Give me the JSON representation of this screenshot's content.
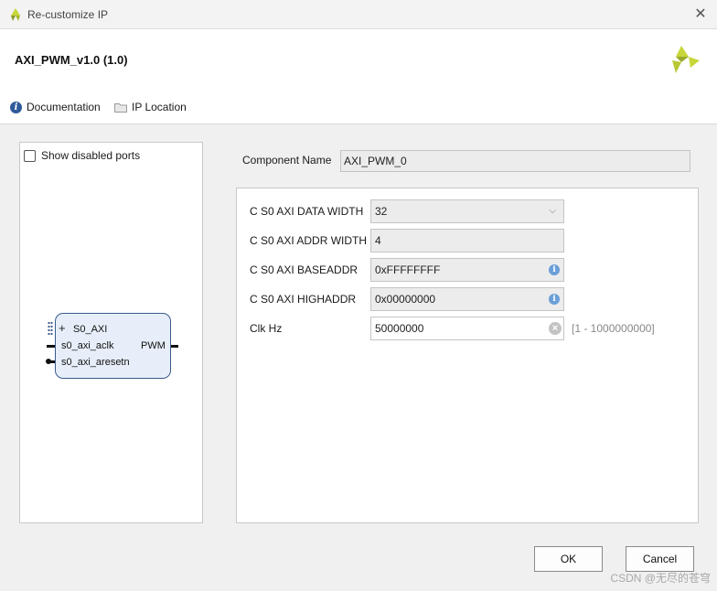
{
  "window": {
    "title": "Re-customize IP"
  },
  "header": {
    "ip_title": "AXI_PWM_v1.0 (1.0)"
  },
  "toolbar": {
    "documentation_label": "Documentation",
    "ip_location_label": "IP Location"
  },
  "left_panel": {
    "show_disabled_ports_label": "Show disabled ports",
    "show_disabled_ports_checked": false,
    "block": {
      "bus_interface": "S0_AXI",
      "ports_in": [
        "s0_axi_aclk",
        "s0_axi_aresetn"
      ],
      "ports_out": [
        "PWM"
      ]
    }
  },
  "component": {
    "label": "Component Name",
    "value": "AXI_PWM_0"
  },
  "params": [
    {
      "label": "C S0 AXI DATA WIDTH",
      "value": "32"
    },
    {
      "label": "C S0 AXI ADDR WIDTH",
      "value": "4"
    },
    {
      "label": "C S0 AXI BASEADDR",
      "value": "0xFFFFFFFF"
    },
    {
      "label": "C S0 AXI HIGHADDR",
      "value": "0x00000000"
    },
    {
      "label": "Clk Hz",
      "value": "50000000",
      "range": "[1 - 1000000000]"
    }
  ],
  "buttons": {
    "ok": "OK",
    "cancel": "Cancel"
  },
  "watermark": "CSDN @无尽的苍穹",
  "colors": {
    "accent": "#2e5a9a",
    "logo": "#c7d63a",
    "block_fill": "#e7eef9",
    "block_border": "#3a5b8c"
  }
}
